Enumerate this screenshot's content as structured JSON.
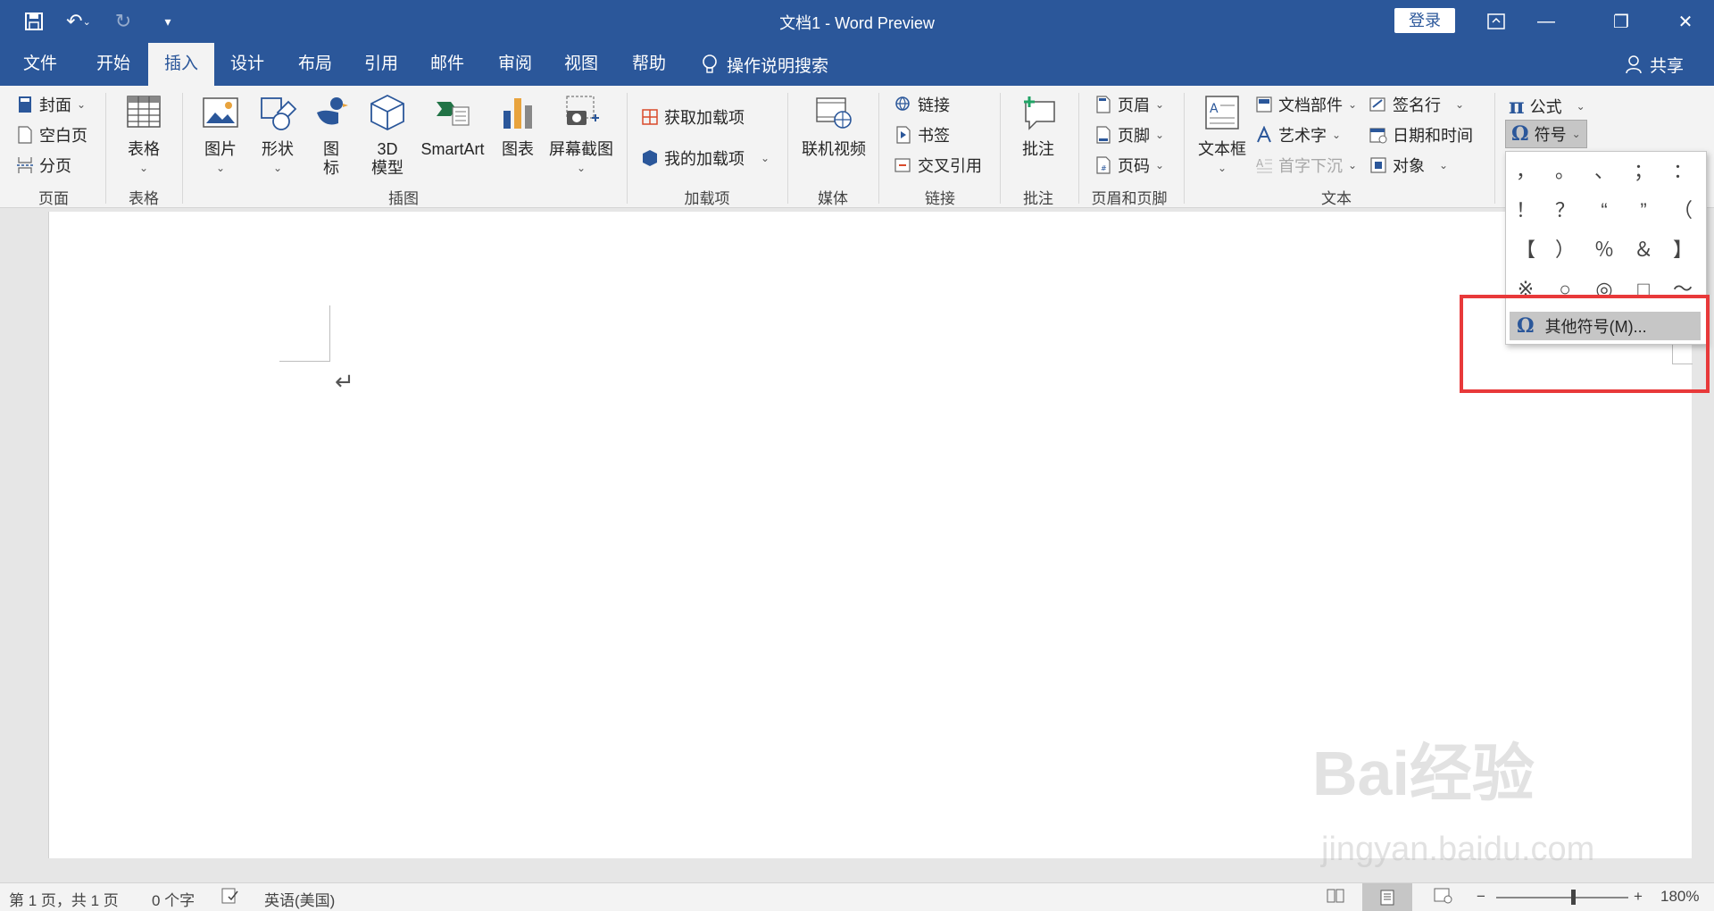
{
  "title_bar": {
    "document_title": "文档1  -  Word Preview",
    "login_label": "登录"
  },
  "tabs": [
    {
      "label": "文件"
    },
    {
      "label": "开始"
    },
    {
      "label": "插入"
    },
    {
      "label": "设计"
    },
    {
      "label": "布局"
    },
    {
      "label": "引用"
    },
    {
      "label": "邮件"
    },
    {
      "label": "审阅"
    },
    {
      "label": "视图"
    },
    {
      "label": "帮助"
    }
  ],
  "active_tab": "插入",
  "tell_me": "操作说明搜索",
  "share_label": "共享",
  "ribbon": {
    "pages": {
      "cover": "封面",
      "blank": "空白页",
      "break": "分页",
      "group": "页面"
    },
    "tables": {
      "table": "表格",
      "group": "表格"
    },
    "illustrations": {
      "pictures": "图片",
      "shapes": "形状",
      "icons_l1": "图",
      "icons_l2": "标",
      "model_l1": "3D",
      "model_l2": "模型",
      "smartart": "SmartArt",
      "chart": "图表",
      "screenshot": "屏幕截图",
      "group": "插图"
    },
    "addins": {
      "get": "获取加载项",
      "mine": "我的加载项",
      "group": "加载项"
    },
    "media": {
      "online_video": "联机视频",
      "group": "媒体"
    },
    "links": {
      "link": "链接",
      "bookmark": "书签",
      "crossref": "交叉引用",
      "group": "链接"
    },
    "comments": {
      "comment": "批注",
      "group": "批注"
    },
    "header_footer": {
      "header": "页眉",
      "footer": "页脚",
      "page_number": "页码",
      "group": "页眉和页脚"
    },
    "text": {
      "textbox": "文本框",
      "quick_parts": "文档部件",
      "wordart": "艺术字",
      "dropcap": "首字下沉",
      "signature": "签名行",
      "datetime": "日期和时间",
      "object": "对象",
      "group": "文本"
    },
    "symbols": {
      "equation": "公式",
      "symbol": "符号"
    }
  },
  "symbol_dropdown": {
    "rows": [
      [
        "，",
        "。",
        "、",
        "；",
        "："
      ],
      [
        "！",
        "？",
        "“",
        "”",
        "（"
      ],
      [
        "【",
        "）",
        "％",
        "＆",
        "】"
      ],
      [
        "※",
        "○",
        "◎",
        "□",
        "～"
      ]
    ],
    "more_symbols": "其他符号(M)..."
  },
  "status_bar": {
    "page": "第 1 页，共 1 页",
    "words": "0 个字",
    "language": "英语(美国)",
    "zoom": "180%"
  },
  "watermark": {
    "brand": "Bai经验",
    "url": "jingyan.baidu.com"
  },
  "colors": {
    "accent": "#2b579a",
    "highlight_box": "#e8393a"
  }
}
